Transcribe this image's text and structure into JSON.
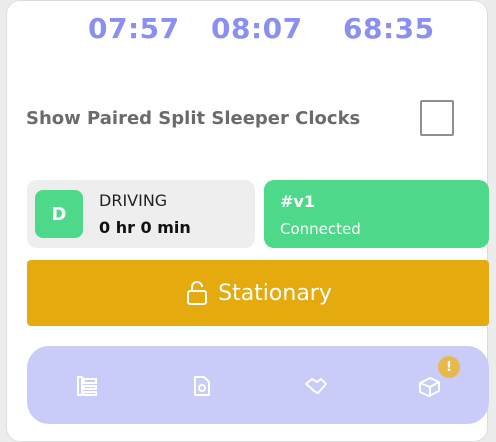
{
  "clocks": [
    "07:57",
    "08:07",
    "68:35"
  ],
  "split_sleeper": {
    "label": "Show Paired Split Sleeper Clocks",
    "checked": false
  },
  "status": {
    "badge": "D",
    "title": "DRIVING",
    "duration": "0 hr 0 min"
  },
  "device": {
    "id": "#v1",
    "state": "Connected"
  },
  "stationary_button": {
    "label": "Stationary",
    "icon": "lock-open-icon"
  },
  "nav": {
    "items": [
      {
        "icon": "logs-icon"
      },
      {
        "icon": "document-icon"
      },
      {
        "icon": "handshake-icon"
      },
      {
        "icon": "package-icon"
      }
    ],
    "alert_badge": "!"
  },
  "colors": {
    "clock": "#8a8ff2",
    "green": "#4ed98a",
    "stationary": "#e5aa0e",
    "nav_bg": "#c9ccf9",
    "alert": "#e6b94a"
  }
}
